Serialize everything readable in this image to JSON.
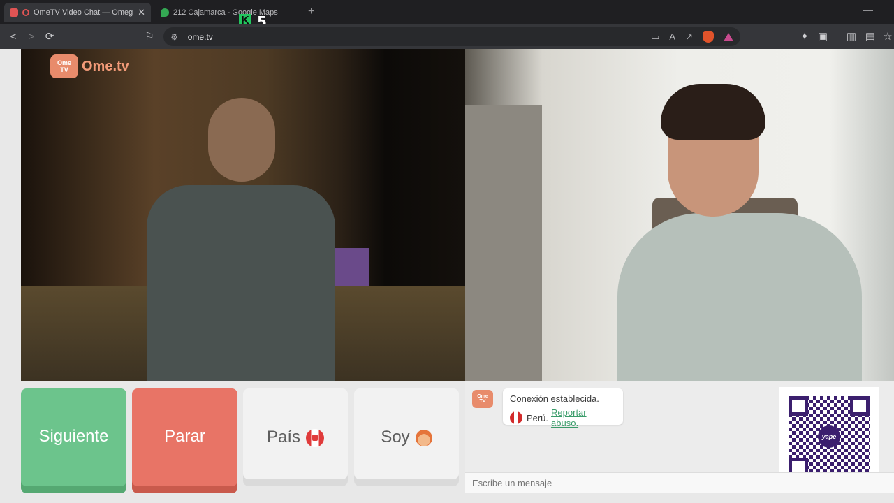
{
  "browser": {
    "tabs": [
      {
        "title": "OmeTV Video Chat — Omegle",
        "active": true
      },
      {
        "title": "212 Cajamarca - Google Maps",
        "active": false
      }
    ],
    "url": "ome.tv",
    "overlay_k": "K",
    "overlay_number": "5"
  },
  "site": {
    "logo_badge_line1": "Ome",
    "logo_badge_line2": "TV",
    "logo_text": "Ome.tv"
  },
  "controls": {
    "next_label": "Siguiente",
    "stop_label": "Parar",
    "country_label": "País",
    "gender_label": "Soy"
  },
  "chat": {
    "status_message": "Conexión establecida.",
    "country": "Perú.",
    "report_link": "Reportar abuso.",
    "input_placeholder": "Escribe un mensaje",
    "qr_brand": "yape"
  },
  "colors": {
    "next_button": "#6cc48c",
    "stop_button": "#e87466",
    "report_link": "#3a9c6a",
    "qr": "#3b1f6e"
  }
}
